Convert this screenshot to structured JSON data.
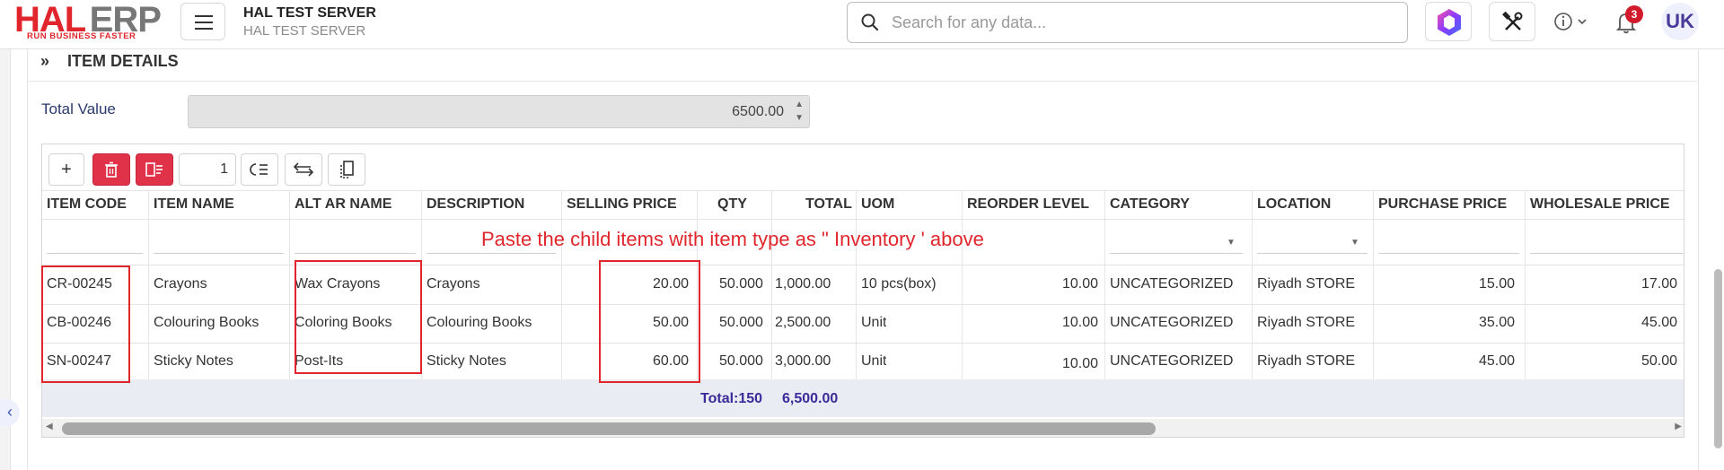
{
  "header": {
    "logo_text_1": "HAL",
    "logo_text_2": "ERP",
    "logo_tagline": "RUN BUSINESS FASTER",
    "server_title": "HAL TEST SERVER",
    "server_subtitle": "HAL TEST SERVER",
    "search_placeholder": "Search for any data...",
    "notification_count": "3",
    "avatar_initials": "UK"
  },
  "section": {
    "title": "ITEM DETAILS",
    "total_value_label": "Total Value",
    "total_value": "6500.00"
  },
  "toolbar": {
    "page_size": "1"
  },
  "annotation": "Paste the child items with item type as \" Inventory ' above",
  "table": {
    "columns": [
      "ITEM CODE",
      "ITEM NAME",
      "ALT AR NAME",
      "DESCRIPTION",
      "SELLING PRICE",
      "QTY",
      "TOTAL",
      "UOM",
      "REORDER LEVEL",
      "CATEGORY",
      "LOCATION",
      "PURCHASE PRICE",
      "WHOLESALE PRICE"
    ],
    "rows": [
      [
        "CR-00245",
        "Crayons",
        "Wax Crayons",
        "Crayons",
        "20.00",
        "50.000",
        "1,000.00",
        "10 pcs(box)",
        "10.00",
        "UNCATEGORIZED",
        "Riyadh STORE",
        "15.00",
        "17.00"
      ],
      [
        "CB-00246",
        "Colouring Books",
        "Coloring Books",
        "Colouring Books",
        "50.00",
        "50.000",
        "2,500.00",
        "Unit",
        "10.00",
        "UNCATEGORIZED",
        "Riyadh STORE",
        "35.00",
        "45.00"
      ],
      [
        "SN-00247",
        "Sticky Notes",
        "Post-Its",
        "Sticky Notes",
        "60.00",
        "50.000",
        "3,000.00",
        "Unit",
        "10.00",
        "UNCATEGORIZED",
        "Riyadh STORE",
        "45.00",
        "50.00"
      ]
    ],
    "qty_total": "Total:150",
    "grand_total": "6,500.00"
  },
  "colors": {
    "brand_red": "#e0262c",
    "accent": "#3a2a9a"
  }
}
